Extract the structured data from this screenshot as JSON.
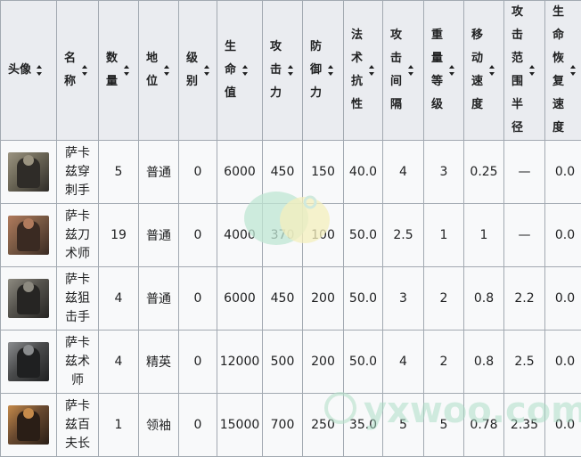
{
  "headers": [
    {
      "key": "portrait",
      "label": "头像"
    },
    {
      "key": "name",
      "label": "名称"
    },
    {
      "key": "count",
      "label": "数量"
    },
    {
      "key": "status",
      "label": "地位"
    },
    {
      "key": "level",
      "label": "级别"
    },
    {
      "key": "hp",
      "label": "生命值"
    },
    {
      "key": "atk",
      "label": "攻击力"
    },
    {
      "key": "def",
      "label": "防御力"
    },
    {
      "key": "res",
      "label": "法术抗性"
    },
    {
      "key": "interval",
      "label": "攻击间隔"
    },
    {
      "key": "weight",
      "label": "重量等级"
    },
    {
      "key": "speed",
      "label": "移动速度"
    },
    {
      "key": "range",
      "label": "攻击范围半径"
    },
    {
      "key": "regen",
      "label": "生命恢复速度"
    }
  ],
  "rows": [
    {
      "portrait_icon": "sarkaz-centurion-portrait-icon",
      "portrait_colors": [
        "#6b6656",
        "#2f2c28",
        "#9a9380"
      ],
      "name_lines": [
        "萨卡",
        "兹穿",
        "刺手"
      ],
      "count": "5",
      "status": "普通",
      "level": "0",
      "hp": "6000",
      "atk": "450",
      "def": "150",
      "res": "40.0",
      "interval": "4",
      "weight": "3",
      "speed": "0.25",
      "range": "—",
      "regen": "0.0"
    },
    {
      "portrait_icon": "sarkaz-bladeweaver-portrait-icon",
      "portrait_colors": [
        "#7a5a44",
        "#3a2a22",
        "#b07a5c"
      ],
      "name_lines": [
        "萨卡",
        "兹刀",
        "术师"
      ],
      "count": "19",
      "status": "普通",
      "level": "0",
      "hp": "4000",
      "atk": "370",
      "def": "100",
      "res": "50.0",
      "interval": "2.5",
      "weight": "1",
      "speed": "1",
      "range": "—",
      "regen": "0.0"
    },
    {
      "portrait_icon": "sarkaz-sniper-portrait-icon",
      "portrait_colors": [
        "#55534d",
        "#262523",
        "#8d8a80"
      ],
      "name_lines": [
        "萨卡",
        "兹狙",
        "击手"
      ],
      "count": "4",
      "status": "普通",
      "level": "0",
      "hp": "6000",
      "atk": "450",
      "def": "200",
      "res": "50.0",
      "interval": "3",
      "weight": "2",
      "speed": "0.8",
      "range": "2.2",
      "regen": "0.0"
    },
    {
      "portrait_icon": "sarkaz-caster-portrait-icon",
      "portrait_colors": [
        "#4a4b4c",
        "#1f2021",
        "#8a8c8e"
      ],
      "name_lines": [
        "萨卡",
        "兹术",
        "师"
      ],
      "count": "4",
      "status": "精英",
      "level": "0",
      "hp": "12000",
      "atk": "500",
      "def": "200",
      "res": "50.0",
      "interval": "4",
      "weight": "2",
      "speed": "0.8",
      "range": "2.5",
      "regen": "0.0"
    },
    {
      "portrait_icon": "sarkaz-centurion-leader-portrait-icon",
      "portrait_colors": [
        "#6a4a30",
        "#2a1e16",
        "#c58a4a"
      ],
      "name_lines": [
        "萨卡",
        "兹百",
        "夫长"
      ],
      "count": "1",
      "status": "领袖",
      "level": "0",
      "hp": "15000",
      "atk": "700",
      "def": "250",
      "res": "35.0",
      "interval": "5",
      "weight": "5",
      "speed": "0.78",
      "range": "2.35",
      "regen": "0.0"
    }
  ],
  "watermark": {
    "text": "yxwoo.com",
    "colors": [
      "#a8dcc4",
      "#f3ecb0",
      "#c8ead8"
    ]
  }
}
